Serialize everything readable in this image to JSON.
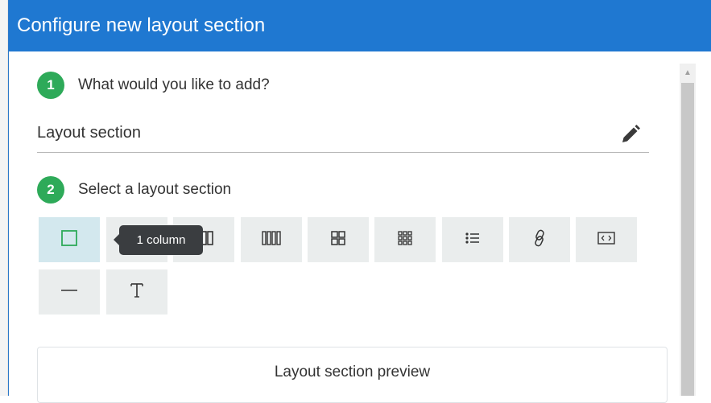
{
  "dialog": {
    "title": "Configure new layout section"
  },
  "step1": {
    "number": "1",
    "text": "What would you like to add?"
  },
  "field": {
    "value": "Layout section"
  },
  "step2": {
    "number": "2",
    "text": "Select a layout section"
  },
  "tiles": [
    {
      "icon": "one-column-icon",
      "glyph": "□",
      "selected": true
    },
    {
      "icon": "two-column-icon",
      "glyph": "▯▯",
      "selected": false
    },
    {
      "icon": "three-column-icon",
      "glyph": "▯▯▯",
      "selected": false
    },
    {
      "icon": "four-column-icon",
      "glyph": "▮▮▮▮",
      "selected": false
    },
    {
      "icon": "grid-four-icon",
      "glyph": "⊞",
      "selected": false
    },
    {
      "icon": "grid-nine-icon",
      "glyph": "▦",
      "selected": false
    },
    {
      "icon": "list-icon",
      "glyph": "☰",
      "selected": false
    },
    {
      "icon": "link-icon",
      "glyph": "∞",
      "selected": false
    },
    {
      "icon": "code-embed-icon",
      "glyph": "‹›",
      "selected": false
    },
    {
      "icon": "divider-icon",
      "glyph": "—",
      "selected": false
    },
    {
      "icon": "text-icon",
      "glyph": "T",
      "selected": false
    }
  ],
  "tooltip": {
    "text": "1 column"
  },
  "preview": {
    "label": "Layout section preview"
  },
  "colors": {
    "header": "#1f78d1",
    "step_badge": "#2eaa59",
    "selected_tile": "#d3e8ee",
    "tile": "#eaeded"
  }
}
